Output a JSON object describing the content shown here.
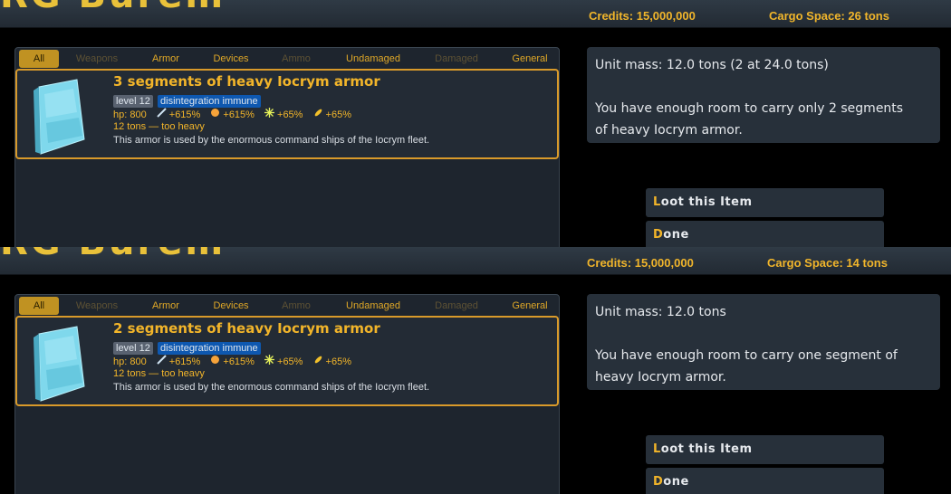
{
  "panels": [
    {
      "logo": "RG Burem",
      "credits": "Credits: 15,000,000",
      "cargo": "Cargo Space:  26 tons",
      "tabs": [
        {
          "label": "All",
          "state": "active"
        },
        {
          "label": "Weapons",
          "state": "dim"
        },
        {
          "label": "Armor",
          "state": "normal"
        },
        {
          "label": "Devices",
          "state": "normal"
        },
        {
          "label": "Ammo",
          "state": "dim"
        },
        {
          "label": "Undamaged",
          "state": "normal"
        },
        {
          "label": "Damaged",
          "state": "dim"
        },
        {
          "label": "General",
          "state": "normal"
        }
      ],
      "item": {
        "title": "3 segments of heavy Iocrym armor",
        "level": "level 12",
        "immune": "disintegration immune",
        "hp": "hp: 800",
        "stat1": "+615%",
        "stat2": "+615%",
        "stat3": "+65%",
        "stat4": "+65%",
        "weight": "12 tons — too heavy",
        "description": "This armor is used by the enormous command ships of the Iocrym fleet."
      },
      "info": {
        "line1": "Unit mass: 12.0 tons (2 at 24.0 tons)",
        "line2": "You have enough room to carry only 2 segments",
        "line3": "of heavy Iocrym armor."
      },
      "loot_hotkey": "L",
      "loot_rest": "oot this Item",
      "done_hotkey": "D",
      "done_rest": "one"
    },
    {
      "logo": "RG Burem",
      "credits": "Credits: 15,000,000",
      "cargo": "Cargo Space:  14 tons",
      "tabs": [
        {
          "label": "All",
          "state": "active"
        },
        {
          "label": "Weapons",
          "state": "dim"
        },
        {
          "label": "Armor",
          "state": "normal"
        },
        {
          "label": "Devices",
          "state": "normal"
        },
        {
          "label": "Ammo",
          "state": "dim"
        },
        {
          "label": "Undamaged",
          "state": "normal"
        },
        {
          "label": "Damaged",
          "state": "dim"
        },
        {
          "label": "General",
          "state": "normal"
        }
      ],
      "item": {
        "title": "2 segments of heavy Iocrym armor",
        "level": "level 12",
        "immune": "disintegration immune",
        "hp": "hp: 800",
        "stat1": "+615%",
        "stat2": "+615%",
        "stat3": "+65%",
        "stat4": "+65%",
        "weight": "12 tons — too heavy",
        "description": "This armor is used by the enormous command ships of the Iocrym fleet."
      },
      "info": {
        "line1": "Unit mass: 12.0 tons",
        "line2": "You have enough room to carry one segment of",
        "line3": "heavy Iocrym armor."
      },
      "loot_hotkey": "L",
      "loot_rest": "oot this Item",
      "done_hotkey": "D",
      "done_rest": "one"
    }
  ],
  "colors": {
    "accent": "#f2b52a",
    "tab_active": "#c09222",
    "item_border": "#d99a2a",
    "immune_badge": "#0e58b0",
    "panel_bg": "#27303a"
  }
}
